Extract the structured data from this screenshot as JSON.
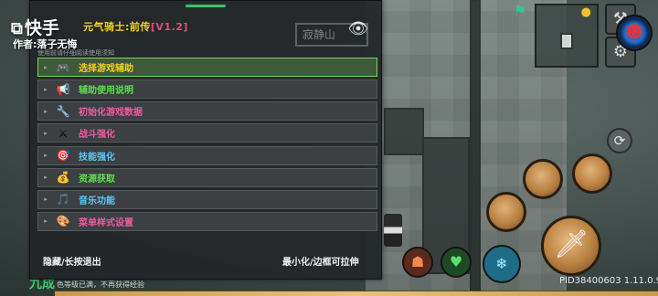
{
  "overlay": {
    "app_logo": "快手",
    "author": "作者:落子无悔"
  },
  "menu_panel": {
    "title": "元气骑士:前传",
    "version": "[V1.2]",
    "subtitle": "使用前请仔细阅读使用须知",
    "items": [
      {
        "label": "选择游戏辅助",
        "icon": "gamepad-icon",
        "glyph": "🎮",
        "color": "#f2d11f",
        "active": true
      },
      {
        "label": "辅助使用说明",
        "icon": "megaphone-icon",
        "glyph": "📢",
        "color": "#5de04b",
        "active": false
      },
      {
        "label": "初始化游戏数据",
        "icon": "wrench-icon",
        "glyph": "🔧",
        "color": "#f05aa0",
        "active": false
      },
      {
        "label": "战斗强化",
        "icon": "crossed-swords-icon",
        "glyph": "⚔",
        "color": "#f05aa0",
        "active": false
      },
      {
        "label": "技能强化",
        "icon": "target-icon",
        "glyph": "🎯",
        "color": "#5ec7f2",
        "active": false
      },
      {
        "label": "资源获取",
        "icon": "money-bag-icon",
        "glyph": "💰",
        "color": "#5de04b",
        "active": false
      },
      {
        "label": "音乐功能",
        "icon": "music-note-icon",
        "glyph": "🎵",
        "color": "#5ec7f2",
        "active": false
      },
      {
        "label": "菜单样式设置",
        "icon": "palette-icon",
        "glyph": "🎨",
        "color": "#f05aa0",
        "active": false
      }
    ],
    "footer_left": "隐藏/长按退出",
    "footer_right": "最小化/边框可拉伸"
  },
  "game_hud": {
    "location_sign": "寂静山",
    "pid_text": "PID38400603 1.11.0.9",
    "bottom_note": "色等级已满，不再获得经验",
    "bottom_tag": "九成"
  },
  "colors": {
    "panel_bg": "#222628",
    "title": "#f2d11f",
    "version": "#e14c7a",
    "active_border": "#7ad35a"
  }
}
